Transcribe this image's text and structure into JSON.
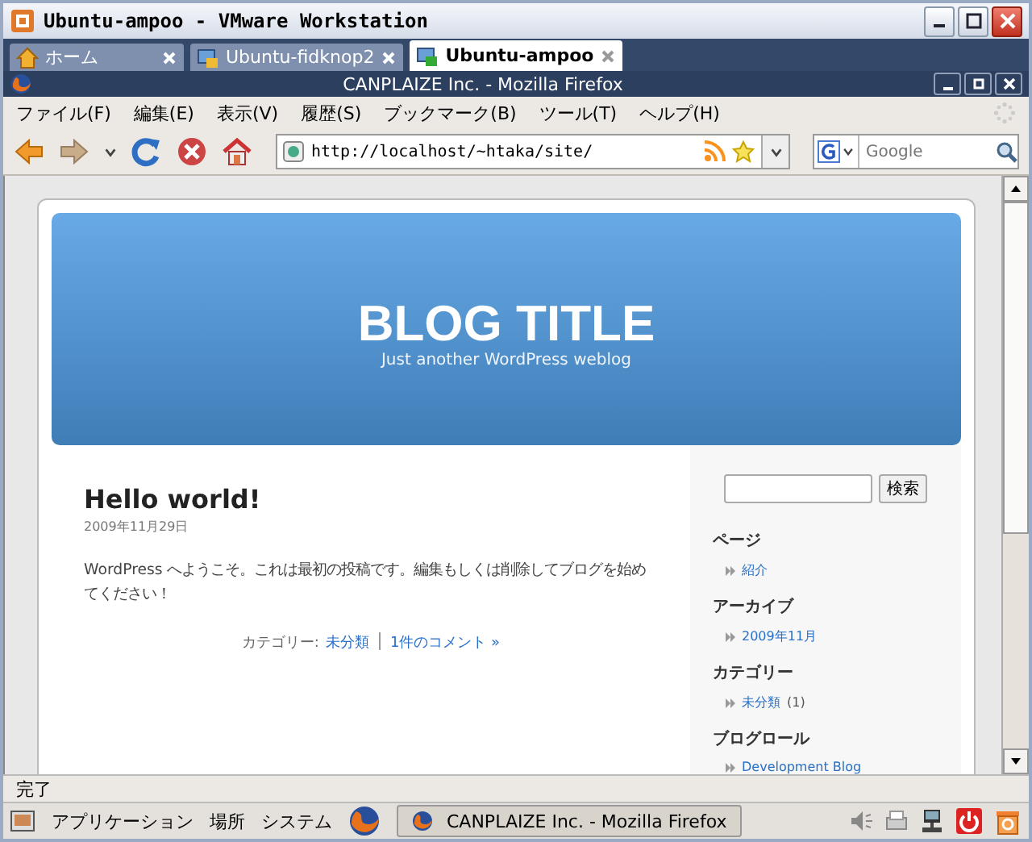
{
  "window": {
    "title": "Ubuntu-ampoo - VMware Workstation"
  },
  "vm_tabs": [
    {
      "label": "ホーム",
      "kind": "home",
      "selected": false
    },
    {
      "label": "Ubuntu-fidknop2",
      "kind": "vm",
      "selected": false
    },
    {
      "label": "Ubuntu-ampoo",
      "kind": "vm",
      "selected": true
    }
  ],
  "browser": {
    "title": "CANPLAIZE Inc. - Mozilla Firefox",
    "menu": [
      "ファイル(F)",
      "編集(E)",
      "表示(V)",
      "履歴(S)",
      "ブックマーク(B)",
      "ツール(T)",
      "ヘルプ(H)"
    ],
    "url": "http://localhost/~htaka/site/",
    "search_placeholder": "Google"
  },
  "page": {
    "blog_title": "BLOG TITLE",
    "tagline": "Just another WordPress weblog",
    "post": {
      "title": "Hello world!",
      "date": "2009年11月29日",
      "body": "WordPress へようこそ。これは最初の投稿です。編集もしくは削除してブログを始めてください！",
      "category_label": "カテゴリー:",
      "category": "未分類",
      "comments": "1件のコメント »"
    },
    "sidebar": {
      "search_button": "検索",
      "sections": [
        {
          "heading": "ページ",
          "links": [
            {
              "text": "紹介"
            }
          ]
        },
        {
          "heading": "アーカイブ",
          "links": [
            {
              "text": "2009年11月"
            }
          ]
        },
        {
          "heading": "カテゴリー",
          "links": [
            {
              "text": "未分類",
              "count": "(1)"
            }
          ]
        },
        {
          "heading": "ブログロール",
          "links": [
            {
              "text": "Development Blog"
            }
          ]
        }
      ]
    }
  },
  "status_bar": "完了",
  "panel": {
    "menus": [
      "アプリケーション",
      "場所",
      "システム"
    ],
    "task": "CANPLAIZE Inc. - Mozilla Firefox"
  }
}
